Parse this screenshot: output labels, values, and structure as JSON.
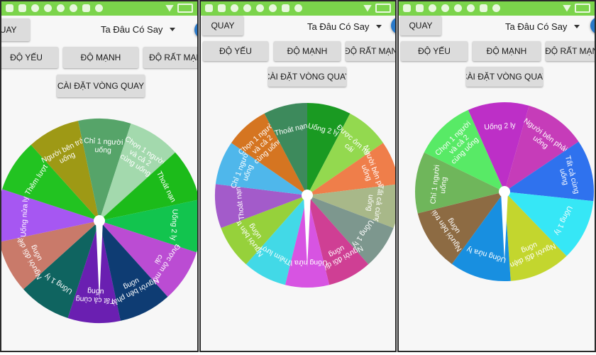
{
  "spin_label": "QUAY",
  "dropdown_value": "Ta Đâu Có Say",
  "levels": [
    "ĐỘ YẾU",
    "ĐỘ MẠNH",
    "ĐỘ RẤT MẠNH"
  ],
  "settings_label": "CÀI ĐẶT VÒNG QUAY",
  "colors": {
    "statusbar": "#7bd44b",
    "button": "#dcdcdc",
    "pointer": "#ffffff",
    "globe": "#2a79c8"
  },
  "icons": [
    "status-icons",
    "wifi-icon",
    "battery-icon",
    "caret-down-icon",
    "globe-icon"
  ],
  "screens": [
    {
      "rotation": 168,
      "segments": [
        {
          "label": "Tất cả cùng uống",
          "color": "#6a1fb1"
        },
        {
          "label": "Uống 1 ly",
          "color": "#0f6460"
        },
        {
          "label": "Người đối diện uống",
          "color": "#c97a6a"
        },
        {
          "label": "Uống nửa ly",
          "color": "#a657f2"
        },
        {
          "label": "Thêm lượt",
          "color": "#22c321"
        },
        {
          "label": "Người bên trái uống",
          "color": "#9e9915"
        },
        {
          "label": "Chỉ 1 người uống",
          "color": "#56a469"
        },
        {
          "label": "Chọn 1 người và cả 2 cùng uống",
          "color": "#a3d9ad"
        },
        {
          "label": "Thoát nạn",
          "color": "#1cbb1a"
        },
        {
          "label": "Uống 2 ly",
          "color": "#12c44e"
        },
        {
          "label": "Được ôm một cái",
          "color": "#bb4cd3"
        },
        {
          "label": "Người bên phải uống",
          "color": "#0e3c73"
        }
      ]
    },
    {
      "rotation": 0,
      "segments": [
        {
          "label": "Uống 2 ly",
          "color": "#1a9a22"
        },
        {
          "label": "Được ôm một cái",
          "color": "#93d94f"
        },
        {
          "label": "Người bên phải uống",
          "color": "#ef7e4a"
        },
        {
          "label": "Tất cả cùng uống",
          "color": "#a8b889"
        },
        {
          "label": "Uống 1 ly",
          "color": "#7d978e"
        },
        {
          "label": "Người đối diện uống",
          "color": "#cf3f94"
        },
        {
          "label": "Uống nửa ly",
          "color": "#d754e2"
        },
        {
          "label": "Thêm lượt",
          "color": "#42d9e7"
        },
        {
          "label": "Người bên trái uống",
          "color": "#96d13b"
        },
        {
          "label": "Thoát nạn",
          "color": "#a35bca"
        },
        {
          "label": "Chỉ 1 người uống",
          "color": "#4fb7eb"
        },
        {
          "label": "Chọn 1 người và cả 2 cùng uống",
          "color": "#d57521"
        },
        {
          "label": "Thoát nạn",
          "color": "#3d8a5c"
        }
      ]
    },
    {
      "rotation": -24,
      "segments": [
        {
          "label": "Uống 2 ly",
          "color": "#bd2fc7"
        },
        {
          "label": "Người bên phải uống",
          "color": "#c63cb9"
        },
        {
          "label": "Tất cả cùng uống",
          "color": "#2f72ee"
        },
        {
          "label": "Uống 1 ly",
          "color": "#36e7f6"
        },
        {
          "label": "Người đối diện uống",
          "color": "#c3d62e"
        },
        {
          "label": "Uống nửa ly",
          "color": "#188fe0"
        },
        {
          "label": "Người bên trái uống",
          "color": "#8d6b43"
        },
        {
          "label": "Chỉ 1 người uống",
          "color": "#6fb65b"
        },
        {
          "label": "Chọn 1 người và cả 2 cùng uống",
          "color": "#58ea66"
        }
      ]
    }
  ]
}
